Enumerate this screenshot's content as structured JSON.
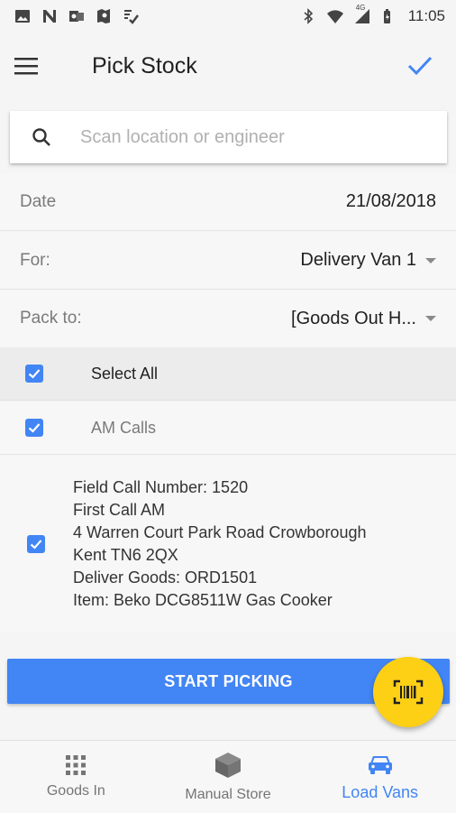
{
  "status_bar": {
    "time": "11:05",
    "network_type": "4G"
  },
  "app_bar": {
    "title": "Pick Stock"
  },
  "search": {
    "placeholder": "Scan location or engineer"
  },
  "form": {
    "date_label": "Date",
    "date_value": "21/08/2018",
    "for_label": "For:",
    "for_value": "Delivery Van 1",
    "pack_label": "Pack to:",
    "pack_value": "[Goods Out H..."
  },
  "selection": {
    "select_all_label": "Select All",
    "group_label": "AM Calls"
  },
  "call": {
    "lines": [
      "Field Call Number: 1520",
      "First Call AM",
      "4 Warren Court Park Road Crowborough",
      "Kent TN6 2QX",
      "Deliver Goods: ORD1501",
      "Item: Beko DCG8511W Gas Cooker"
    ]
  },
  "actions": {
    "start_label": "START PICKING"
  },
  "bottom_nav": {
    "items": [
      {
        "label": "Goods In",
        "icon": "grid-icon"
      },
      {
        "label": "Manual Store",
        "icon": "box-icon"
      },
      {
        "label": "Load Vans",
        "icon": "van-icon"
      }
    ],
    "active_index": 2
  },
  "colors": {
    "accent": "#4285f4",
    "fab": "#fdd015"
  }
}
